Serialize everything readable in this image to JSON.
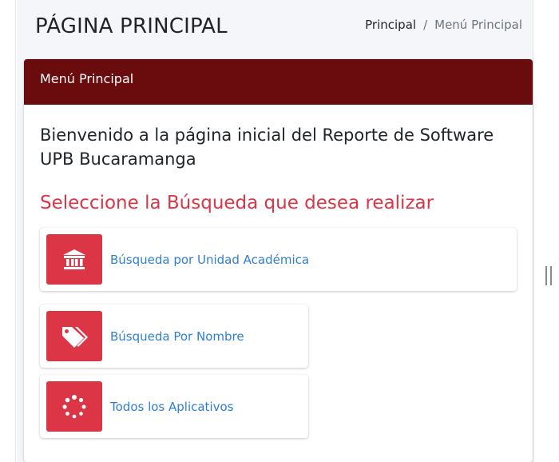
{
  "header": {
    "title": "PÁGINA PRINCIPAL",
    "breadcrumb": [
      {
        "label": "Principal"
      },
      {
        "label": "Menú Principal"
      }
    ],
    "separator": "/"
  },
  "card": {
    "header_title": "Menú Principal",
    "welcome_text": "Bienvenido a la página inicial del Reporte de Software UPB Bucaramanga",
    "subtitle": "Seleccione la Búsqueda que desea realizar"
  },
  "options": [
    {
      "label": "Búsqueda por Unidad Académica",
      "icon": "university-icon"
    },
    {
      "label": "Búsqueda Por Nombre",
      "icon": "tags-icon"
    },
    {
      "label": "Todos los Aplicativos",
      "icon": "spinner-icon"
    }
  ],
  "colors": {
    "card_header": "#6a0b0e",
    "accent_red": "#dc3545",
    "link_blue": "#2f7fd1"
  }
}
